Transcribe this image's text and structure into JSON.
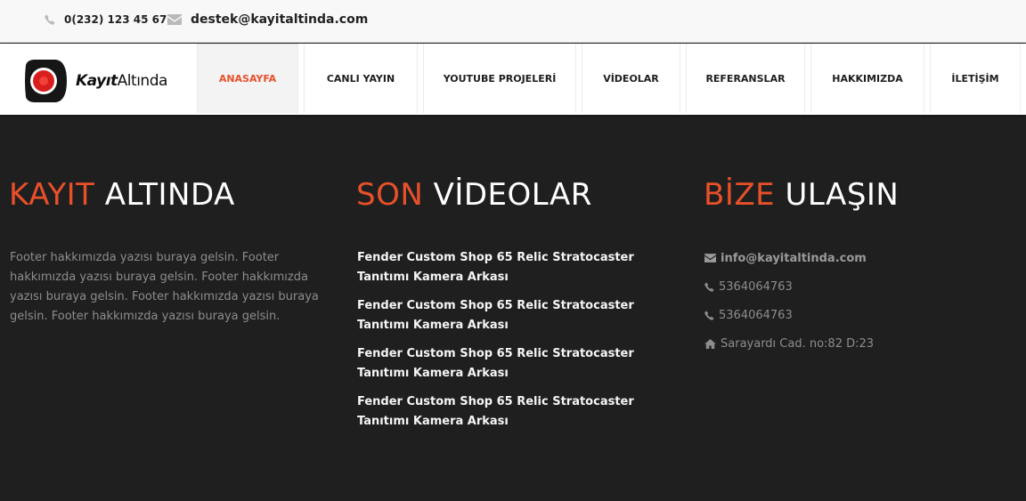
{
  "topbar": {
    "phone": "0(232) 123 45 67",
    "phone_icon": "phone-icon",
    "email": "destek@kayitaltinda.com",
    "email_icon": "envelope-icon"
  },
  "brand": {
    "name_bold": "Kayıt",
    "name_light": "Altında",
    "accent_color": "#e8502a"
  },
  "nav": {
    "items": [
      {
        "label": "ANASAYFA",
        "active": true
      },
      {
        "label": "CANLI YAYIN",
        "active": false
      },
      {
        "label": "YOUTUBE PROJELERİ",
        "active": false
      },
      {
        "label": "VİDEOLAR",
        "active": false
      },
      {
        "label": "REFERANSLAR",
        "active": false
      },
      {
        "label": "HAKKIMIZDA",
        "active": false
      },
      {
        "label": "İLETİŞİM",
        "active": false
      }
    ]
  },
  "footer": {
    "about": {
      "title_accent": "KAYIT",
      "title_rest": "ALTINDA",
      "text": "Footer hakkımızda yazısı buraya gelsin. Footer hakkımızda yazısı buraya gelsin. Footer hakkımızda yazısı buraya gelsin. Footer hakkımızda yazısı buraya gelsin. Footer hakkımızda yazısı buraya gelsin."
    },
    "videos": {
      "title_accent": "SON",
      "title_rest": "VİDEOLAR",
      "items": [
        "Fender Custom Shop 65 Relic Stratocaster Tanıtımı Kamera Arkası",
        "Fender Custom Shop 65 Relic Stratocaster Tanıtımı Kamera Arkası",
        "Fender Custom Shop 65 Relic Stratocaster Tanıtımı Kamera Arkası",
        "Fender Custom Shop 65 Relic Stratocaster Tanıtımı Kamera Arkası"
      ]
    },
    "contact": {
      "title_accent": "BİZE",
      "title_rest": "ULAŞIN",
      "email": "info@kayitaltinda.com",
      "phone_1": "5364064763",
      "phone_2": "5364064763",
      "address": "Sarayardı Cad. no:82 D:23"
    }
  }
}
